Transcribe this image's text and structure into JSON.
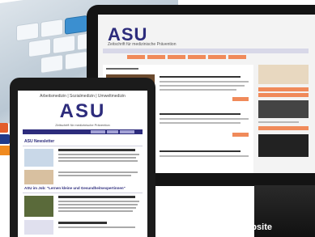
{
  "website": {
    "logo": "ASU",
    "tagline": "Zeitschrift für medizinische Prävention"
  },
  "tablet": {
    "header_small": "Arbeitsmedizin | Sozialmedizin | Umweltmedizin",
    "logo": "ASU",
    "tagline": "Zeitschrift für medizinische Prävention",
    "section_1": "ASU Newsletter",
    "section_2": "ASU im Job: \"Lernen kleine und Gesundheitsexpertinnen\""
  },
  "caption": "Website"
}
